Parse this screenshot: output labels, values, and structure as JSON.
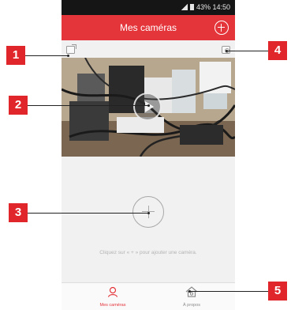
{
  "statusbar": {
    "text": "43% 14:50"
  },
  "header": {
    "title": "Mes caméras",
    "add_icon": "plus-circle-icon"
  },
  "camera": {
    "share_icon": "share-icon",
    "settings_icon": "settings-icon",
    "play_icon": "play-icon"
  },
  "add_camera": {
    "icon": "plus-circle-icon",
    "hint": "Cliquez sur « + » pour ajouter une caméra."
  },
  "tabbar": {
    "tabs": [
      {
        "label": "Mes caméras",
        "icon": "person-icon"
      },
      {
        "label": "À propos",
        "icon": "home-icon"
      }
    ]
  },
  "callouts": [
    "1",
    "2",
    "3",
    "4",
    "5"
  ],
  "colors": {
    "accent": "#e4353b",
    "callout": "#e0262b"
  }
}
